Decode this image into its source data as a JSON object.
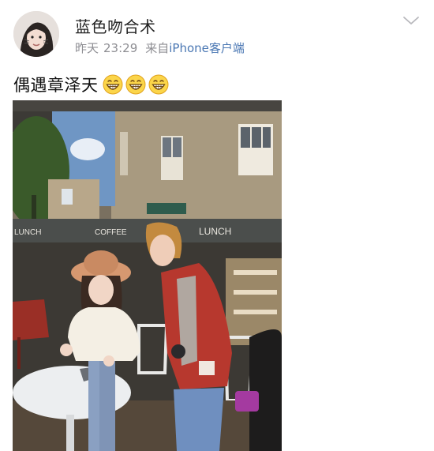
{
  "post": {
    "author": "蓝色吻合术",
    "time_prefix": "昨天",
    "time": "23:29",
    "source_prefix": "来自",
    "source_device": "iPhone客户端",
    "text": "偶遇章泽天",
    "emoji_count": 3
  },
  "icons": {
    "more": "chevron-down-icon",
    "emoji": "grin-emoji-icon"
  },
  "photo": {
    "signs": [
      "LUNCH",
      "COFFEE",
      "LUNCH"
    ]
  },
  "colors": {
    "author_text": "#222222",
    "meta_text": "#8e8e93",
    "device_link": "#4a77b3"
  }
}
